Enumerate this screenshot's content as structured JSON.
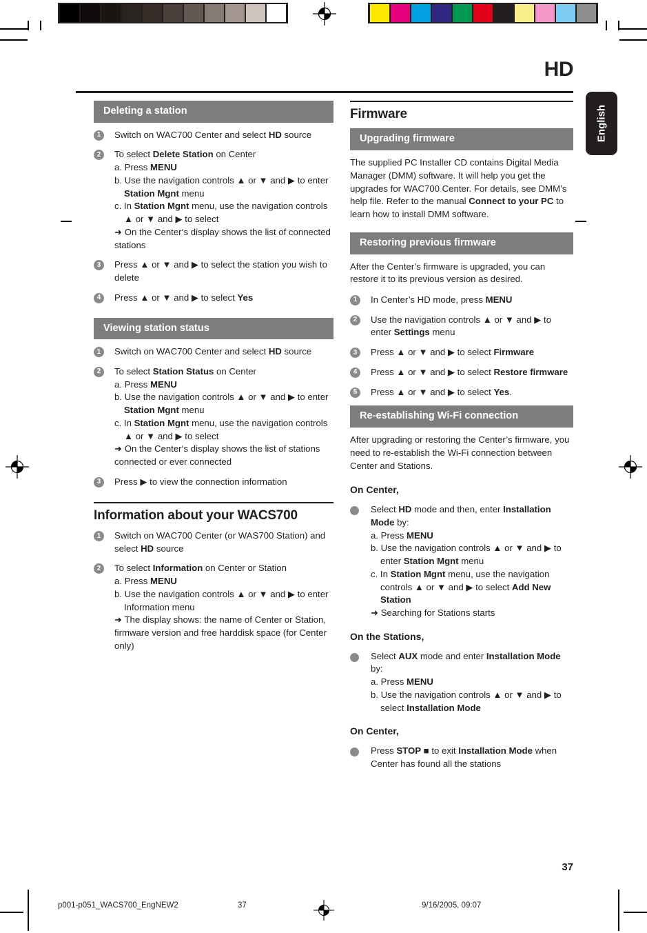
{
  "header": {
    "chapter_title": "HD",
    "language_tab": "English",
    "page_number": "37"
  },
  "calibration": {
    "gray_swatches": [
      "#000000",
      "#0d0a09",
      "#1a1513",
      "#2a2320",
      "#362d29",
      "#4b403b",
      "#645952",
      "#857b75",
      "#a2968f",
      "#cfc3bd",
      "#ffffff"
    ],
    "color_swatches": [
      "#ffe800",
      "#e6007e",
      "#00a0e3",
      "#312783",
      "#009a4e",
      "#e3001b",
      "#231f20",
      "#fbef8a",
      "#f598c7",
      "#7ecef4",
      "#8f8f8f"
    ],
    "registration_icon": "registration-target-icon"
  },
  "left_column": {
    "section1": {
      "bar_title": "Deleting a station",
      "steps": [
        {
          "num": "1",
          "lines": [
            {
              "type": "flat",
              "html": "Switch on WAC700 Center and select <b>HD</b> source"
            }
          ]
        },
        {
          "num": "2",
          "lines": [
            {
              "type": "flat",
              "html": "To select <b>Delete Station</b> on Center"
            },
            {
              "type": "sub",
              "html": "a. Press <b>MENU</b>"
            },
            {
              "type": "sub",
              "html": "b. Use the navigation controls ▲ or ▼ and ▶ to enter <b>Station Mgnt</b> menu"
            },
            {
              "type": "sub",
              "html": "c. In <b>Station Mgnt</b> menu,  use the navigation controls ▲ or ▼ and ▶ to select"
            },
            {
              "type": "arrow",
              "html": "➜ On the Center‘s display shows the list of connected stations"
            }
          ]
        },
        {
          "num": "3",
          "lines": [
            {
              "type": "flat",
              "html": "Press ▲ or ▼ and ▶ to select the station you wish to delete"
            }
          ]
        },
        {
          "num": "4",
          "lines": [
            {
              "type": "flat",
              "html": "Press ▲ or ▼ and ▶ to select <b>Yes</b>"
            }
          ]
        }
      ]
    },
    "section2": {
      "bar_title": "Viewing station status",
      "steps": [
        {
          "num": "1",
          "lines": [
            {
              "type": "flat",
              "html": "Switch on WAC700 Center and select <b>HD</b> source"
            }
          ]
        },
        {
          "num": "2",
          "lines": [
            {
              "type": "flat",
              "html": "To select <b>Station Status</b> on Center"
            },
            {
              "type": "sub",
              "html": "a. Press <b>MENU</b>"
            },
            {
              "type": "sub",
              "html": "b. Use the navigation controls ▲ or ▼ and ▶ to enter <b>Station Mgnt</b> menu"
            },
            {
              "type": "sub",
              "html": "c.  In <b>Station Mgnt</b> menu,  use the navigation controls ▲ or ▼ and ▶ to select"
            },
            {
              "type": "arrow",
              "html": "➜ On the Center‘s display shows the list of stations connected or ever connected"
            }
          ]
        },
        {
          "num": "3",
          "lines": [
            {
              "type": "flat",
              "html": "Press ▶ to view the connection information"
            }
          ]
        }
      ]
    },
    "section3": {
      "heading": "Information about your WACS700",
      "steps": [
        {
          "num": "1",
          "lines": [
            {
              "type": "flat",
              "html": "Switch on WAC700 Center (or WAS700 Station) and select <b>HD</b> source"
            }
          ]
        },
        {
          "num": "2",
          "lines": [
            {
              "type": "flat",
              "html": "To select <b>Information</b> on Center or Station"
            },
            {
              "type": "sub",
              "html": "a. Press <b>MENU</b>"
            },
            {
              "type": "sub",
              "html": "b. Use the navigation controls ▲ or ▼ and ▶ to enter Information menu"
            },
            {
              "type": "arrow",
              "html": "➜ The display shows: the name of Center or Station, firmware version and free harddisk space (for Center only)"
            }
          ]
        }
      ]
    }
  },
  "right_column": {
    "heading": "Firmware",
    "section1": {
      "bar_title": "Upgrading firmware",
      "body": "The supplied PC Installer CD contains Digital Media Manager (DMM) software.  It will help you get the upgrades for WAC700 Center. For details, see DMM’s help file. Refer to the manual <b>Connect to your PC</b> to learn how to install DMM software."
    },
    "section2": {
      "bar_title": "Restoring previous firmware",
      "intro": "After the Center’s firmware is upgraded, you can restore it to its previous version as desired.",
      "steps": [
        {
          "num": "1",
          "lines": [
            {
              "type": "flat",
              "html": "In Center’s HD mode, press <b>MENU</b>"
            }
          ]
        },
        {
          "num": "2",
          "lines": [
            {
              "type": "flat",
              "html": "Use the navigation controls ▲ or ▼ and ▶ to enter <b>Settings</b> menu"
            }
          ]
        },
        {
          "num": "3",
          "lines": [
            {
              "type": "flat",
              "html": "Press ▲ or ▼ and ▶ to select <b>Firmware</b>"
            }
          ]
        },
        {
          "num": "4",
          "lines": [
            {
              "type": "flat",
              "html": "Press ▲ or ▼ and ▶ to select <b>Restore firmware</b>"
            }
          ]
        },
        {
          "num": "5",
          "lines": [
            {
              "type": "flat",
              "html": "Press ▲ or ▼ and ▶ to select <b>Yes</b>."
            }
          ]
        }
      ]
    },
    "section3": {
      "bar_title": "Re-establishing Wi-Fi connection",
      "intro": "After upgrading or restoring the Center’s firmware, you need to re-establish the Wi-Fi connection between Center and Stations.",
      "blocks": [
        {
          "subhead": "On Center,",
          "bullet_lines": [
            {
              "type": "flat",
              "html": "Select <b>HD</b> mode and then, enter <b>Installation Mode</b> by:"
            },
            {
              "type": "sub",
              "html": "a. Press <b>MENU</b>"
            },
            {
              "type": "sub",
              "html": "b. Use the navigation controls ▲ or ▼ and ▶ to enter <b>Station Mgnt</b> menu"
            },
            {
              "type": "sub",
              "html": "c.  In <b>Station Mgnt</b> menu,  use the navigation controls ▲ or ▼ and ▶ to select <b>Add New Station</b>"
            },
            {
              "type": "arrow",
              "html": "➜ Searching for Stations starts"
            }
          ]
        },
        {
          "subhead": "On the Stations,",
          "bullet_lines": [
            {
              "type": "flat",
              "html": "Select <b>AUX</b> mode and enter <b>Installation Mode</b> by:"
            },
            {
              "type": "sub",
              "html": "a. Press <b>MENU</b>"
            },
            {
              "type": "sub",
              "html": "b. Use the navigation controls ▲ or ▼ and ▶ to select <b>Installation Mode</b>"
            }
          ]
        },
        {
          "subhead": "On Center,",
          "bullet_lines": [
            {
              "type": "flat",
              "html": "Press <b>STOP</b> ■ to exit <b>Installation Mode</b> when Center has found all the stations"
            }
          ]
        }
      ]
    }
  },
  "footer": {
    "file_name": "p001-p051_WACS700_EngNEW2",
    "page": "37",
    "timestamp": "9/16/2005, 09:07"
  }
}
